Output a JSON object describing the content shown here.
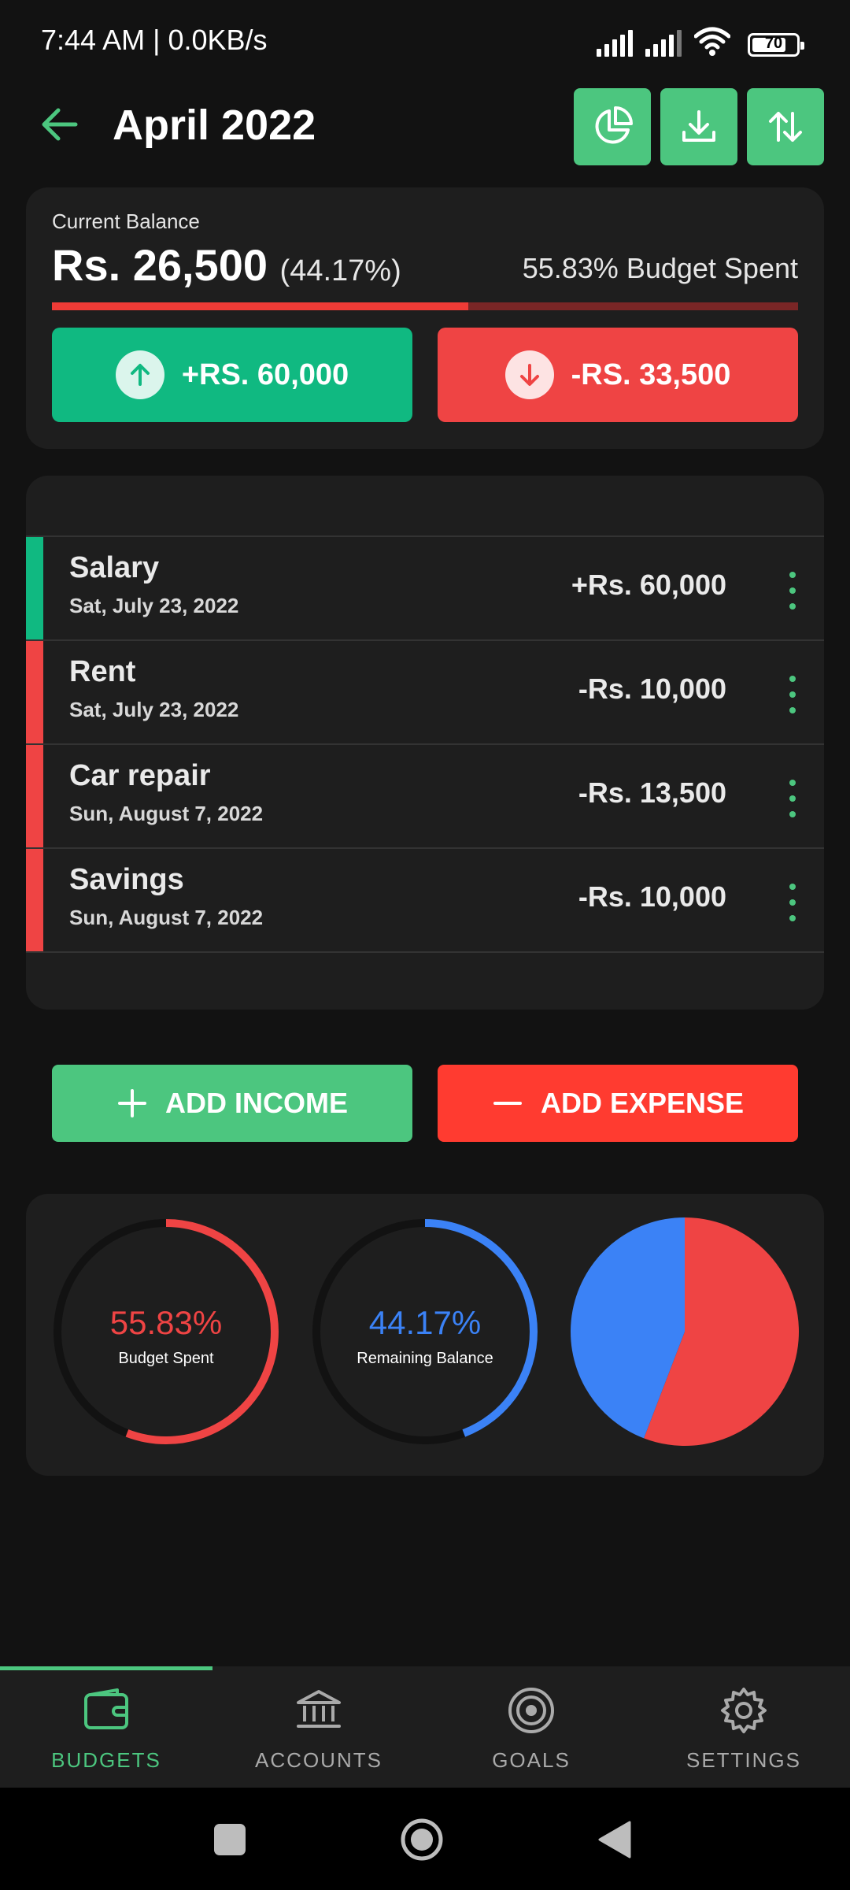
{
  "status_bar": {
    "time_speed": "7:44 AM | 0.0KB/s",
    "battery": "70"
  },
  "header": {
    "title": "April 2022"
  },
  "balance": {
    "label": "Current Balance",
    "amount": "Rs. 26,500",
    "percent": "(44.17%)",
    "budget_spent_text": "55.83% Budget Spent",
    "spent_fraction": 0.5583,
    "income_label": "+RS. 60,000",
    "expense_label": "-RS. 33,500"
  },
  "transactions": [
    {
      "name": "Salary",
      "date": "Sat, July 23, 2022",
      "amount": "+Rs. 60,000",
      "kind": "income"
    },
    {
      "name": "Rent",
      "date": "Sat, July 23, 2022",
      "amount": "-Rs. 10,000",
      "kind": "expense"
    },
    {
      "name": "Car repair",
      "date": "Sun, August 7, 2022",
      "amount": "-Rs. 13,500",
      "kind": "expense"
    },
    {
      "name": "Savings",
      "date": "Sun, August 7, 2022",
      "amount": "-Rs. 10,000",
      "kind": "expense"
    }
  ],
  "actions": {
    "add_income": "ADD INCOME",
    "add_expense": "ADD EXPENSE"
  },
  "stats": {
    "spent_value": "55.83%",
    "spent_label": "Budget Spent",
    "spent_fraction": 0.5583,
    "remaining_value": "44.17%",
    "remaining_label": "Remaining Balance",
    "remaining_fraction": 0.4417
  },
  "chart_data": {
    "type": "pie",
    "categories": [
      "Budget Spent",
      "Remaining Balance"
    ],
    "values": [
      55.83,
      44.17
    ],
    "colors": [
      "#ef4444",
      "#3b82f6"
    ]
  },
  "nav": [
    {
      "label": "BUDGETS",
      "icon": "wallet-icon",
      "active": true
    },
    {
      "label": "ACCOUNTS",
      "icon": "bank-icon",
      "active": false
    },
    {
      "label": "GOALS",
      "icon": "target-icon",
      "active": false
    },
    {
      "label": "SETTINGS",
      "icon": "gear-icon",
      "active": false
    }
  ],
  "colors": {
    "accent": "#4cc67f",
    "income": "#10b981",
    "expense": "#ef4444",
    "add_expense": "#ff3b30",
    "remaining": "#3b82f6",
    "card": "#1e1e1e",
    "background": "#121212"
  }
}
